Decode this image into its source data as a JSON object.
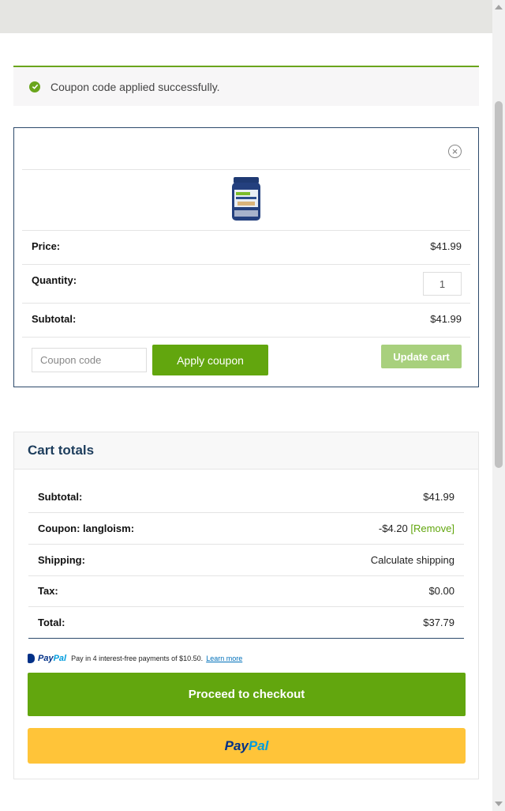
{
  "notice": {
    "message": "Coupon code applied successfully.",
    "color": "#6aa51c"
  },
  "cart": {
    "remove_icon": "close-circle-icon",
    "product_image": "protein-tub-image",
    "price_label": "Price:",
    "price_value": "$41.99",
    "quantity_label": "Quantity:",
    "quantity_value": "1",
    "subtotal_label": "Subtotal:",
    "subtotal_value": "$41.99",
    "coupon_placeholder": "Coupon code",
    "apply_label": "Apply coupon",
    "update_label": "Update cart"
  },
  "totals": {
    "title": "Cart totals",
    "rows": [
      {
        "label": "Subtotal:",
        "value": "$41.99"
      },
      {
        "label": "Coupon: langloism:",
        "value": "-$4.20",
        "extra": "[Remove]"
      },
      {
        "label": "Shipping:",
        "value": "Calculate shipping"
      },
      {
        "label": "Tax:",
        "value": "$0.00"
      },
      {
        "label": "Total:",
        "value": "$37.79"
      }
    ],
    "paypal_message": {
      "brand_pay": "Pay",
      "brand_pal": "Pal",
      "text": "Pay in 4 interest-free payments of $10.50.",
      "link": "Learn more"
    },
    "checkout_label": "Proceed to checkout",
    "paypal_button": {
      "pay": "Pay",
      "pal": "Pal"
    }
  },
  "colors": {
    "primary_green": "#62a60e",
    "navy": "#1d3d5c",
    "paypal_yellow": "#ffc439"
  }
}
